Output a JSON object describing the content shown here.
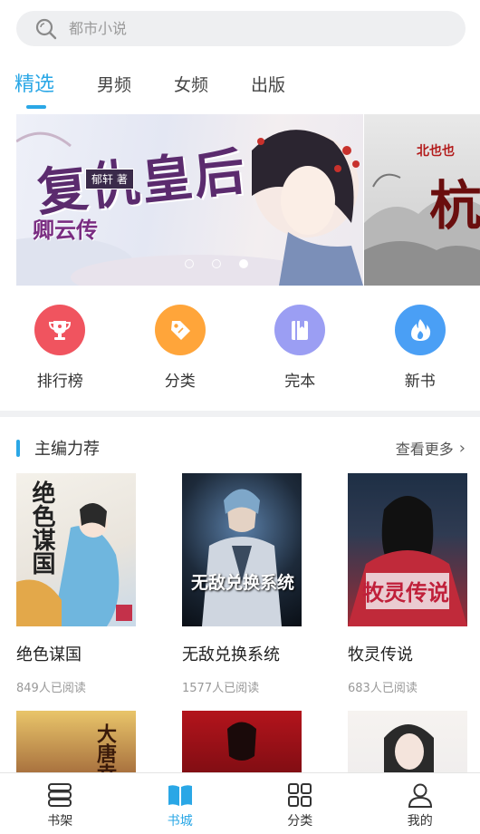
{
  "search": {
    "placeholder": "都市小说"
  },
  "tabs": [
    {
      "label": "精选",
      "active": true
    },
    {
      "label": "男频"
    },
    {
      "label": "女频"
    },
    {
      "label": "出版"
    }
  ],
  "banner": {
    "main": {
      "title": "复仇皇后",
      "subtitle": "卿云传",
      "author": "郁轩 著"
    },
    "next": {
      "title": "北也也",
      "big_char": "杭"
    },
    "slide_count": 3,
    "active_slide": 3
  },
  "categories": [
    {
      "label": "排行榜",
      "icon": "trophy-icon",
      "color": "#f0545f"
    },
    {
      "label": "分类",
      "icon": "tag-icon",
      "color": "#ffa53a"
    },
    {
      "label": "完本",
      "icon": "book-icon",
      "color": "#9b9ef3"
    },
    {
      "label": "新书",
      "icon": "flame-icon",
      "color": "#4a9ff5"
    }
  ],
  "section": {
    "title": "主编力荐",
    "more": "查看更多"
  },
  "books": [
    {
      "name": "绝色谋国",
      "reads": "849人已阅读",
      "cover_title": "绝色谋国"
    },
    {
      "name": "无敌兑换系统",
      "reads": "1577人已阅读",
      "cover_title": "无敌兑换系统"
    },
    {
      "name": "牧灵传说",
      "reads": "683人已阅读",
      "cover_title": "牧灵传说"
    }
  ],
  "books_row2": [
    {
      "cover_title": "大唐幸三"
    },
    {
      "cover_title": ""
    },
    {
      "cover_title": ""
    }
  ],
  "bottom_nav": [
    {
      "label": "书架",
      "icon": "bookshelf-icon"
    },
    {
      "label": "书城",
      "icon": "open-book-icon",
      "active": true
    },
    {
      "label": "分类",
      "icon": "grid-icon"
    },
    {
      "label": "我的",
      "icon": "user-icon"
    }
  ],
  "colors": {
    "accent": "#2aa7e6"
  }
}
